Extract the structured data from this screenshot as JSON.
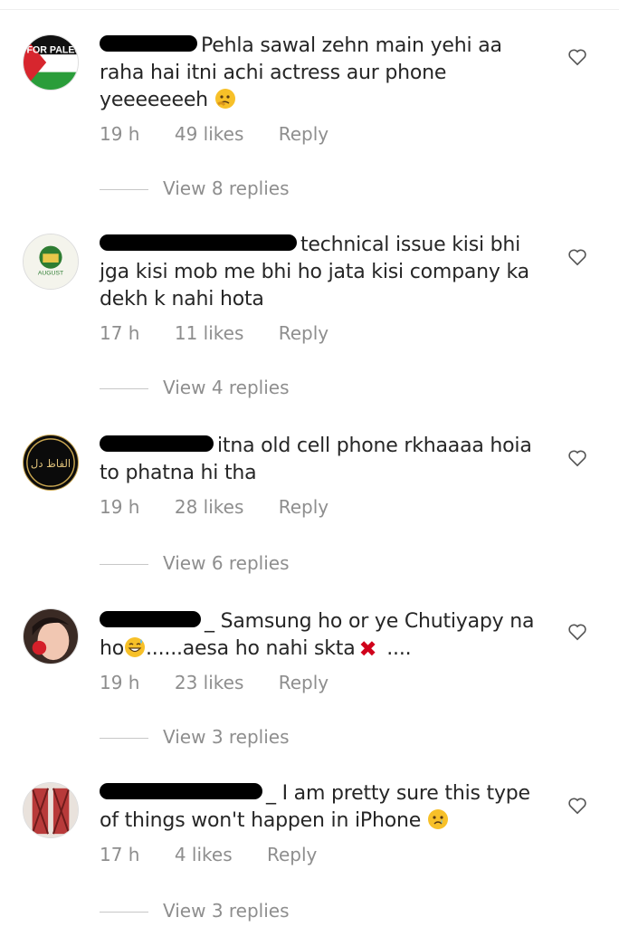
{
  "comments": [
    {
      "text": "Pehla sawal zehn main yehi aa raha hai itni achi actress aur phone yeeeeeeeh",
      "time": "19 h",
      "likes": "49 likes",
      "reply": "Reply",
      "view_replies": "View 8 replies",
      "avatar_text": "PRAY FOR PALESTINE"
    },
    {
      "text": "technical issue kisi bhi jga kisi mob me bhi ho jata kisi company ka dekh k nahi hota",
      "time": "17 h",
      "likes": "11 likes",
      "reply": "Reply",
      "view_replies": "View 4 replies",
      "avatar_text": "AUGUST"
    },
    {
      "text": "itna old cell phone rkhaaaa hoia to phatna hi tha",
      "time": "19 h",
      "likes": "28 likes",
      "reply": "Reply",
      "view_replies": "View 6 replies",
      "avatar_text": "الفاظ دل"
    },
    {
      "text_part1": "_ Samsung ho or ye Chutiyapy na ho",
      "text_part2": "......aesa ho nahi skta",
      "text_part3": " ....",
      "time": "19 h",
      "likes": "23 likes",
      "reply": "Reply",
      "view_replies": "View 3 replies"
    },
    {
      "text": "_ I am pretty sure this type of things won't happen in iPhone",
      "time": "17 h",
      "likes": "4 likes",
      "reply": "Reply",
      "view_replies": "View 3 replies"
    }
  ]
}
